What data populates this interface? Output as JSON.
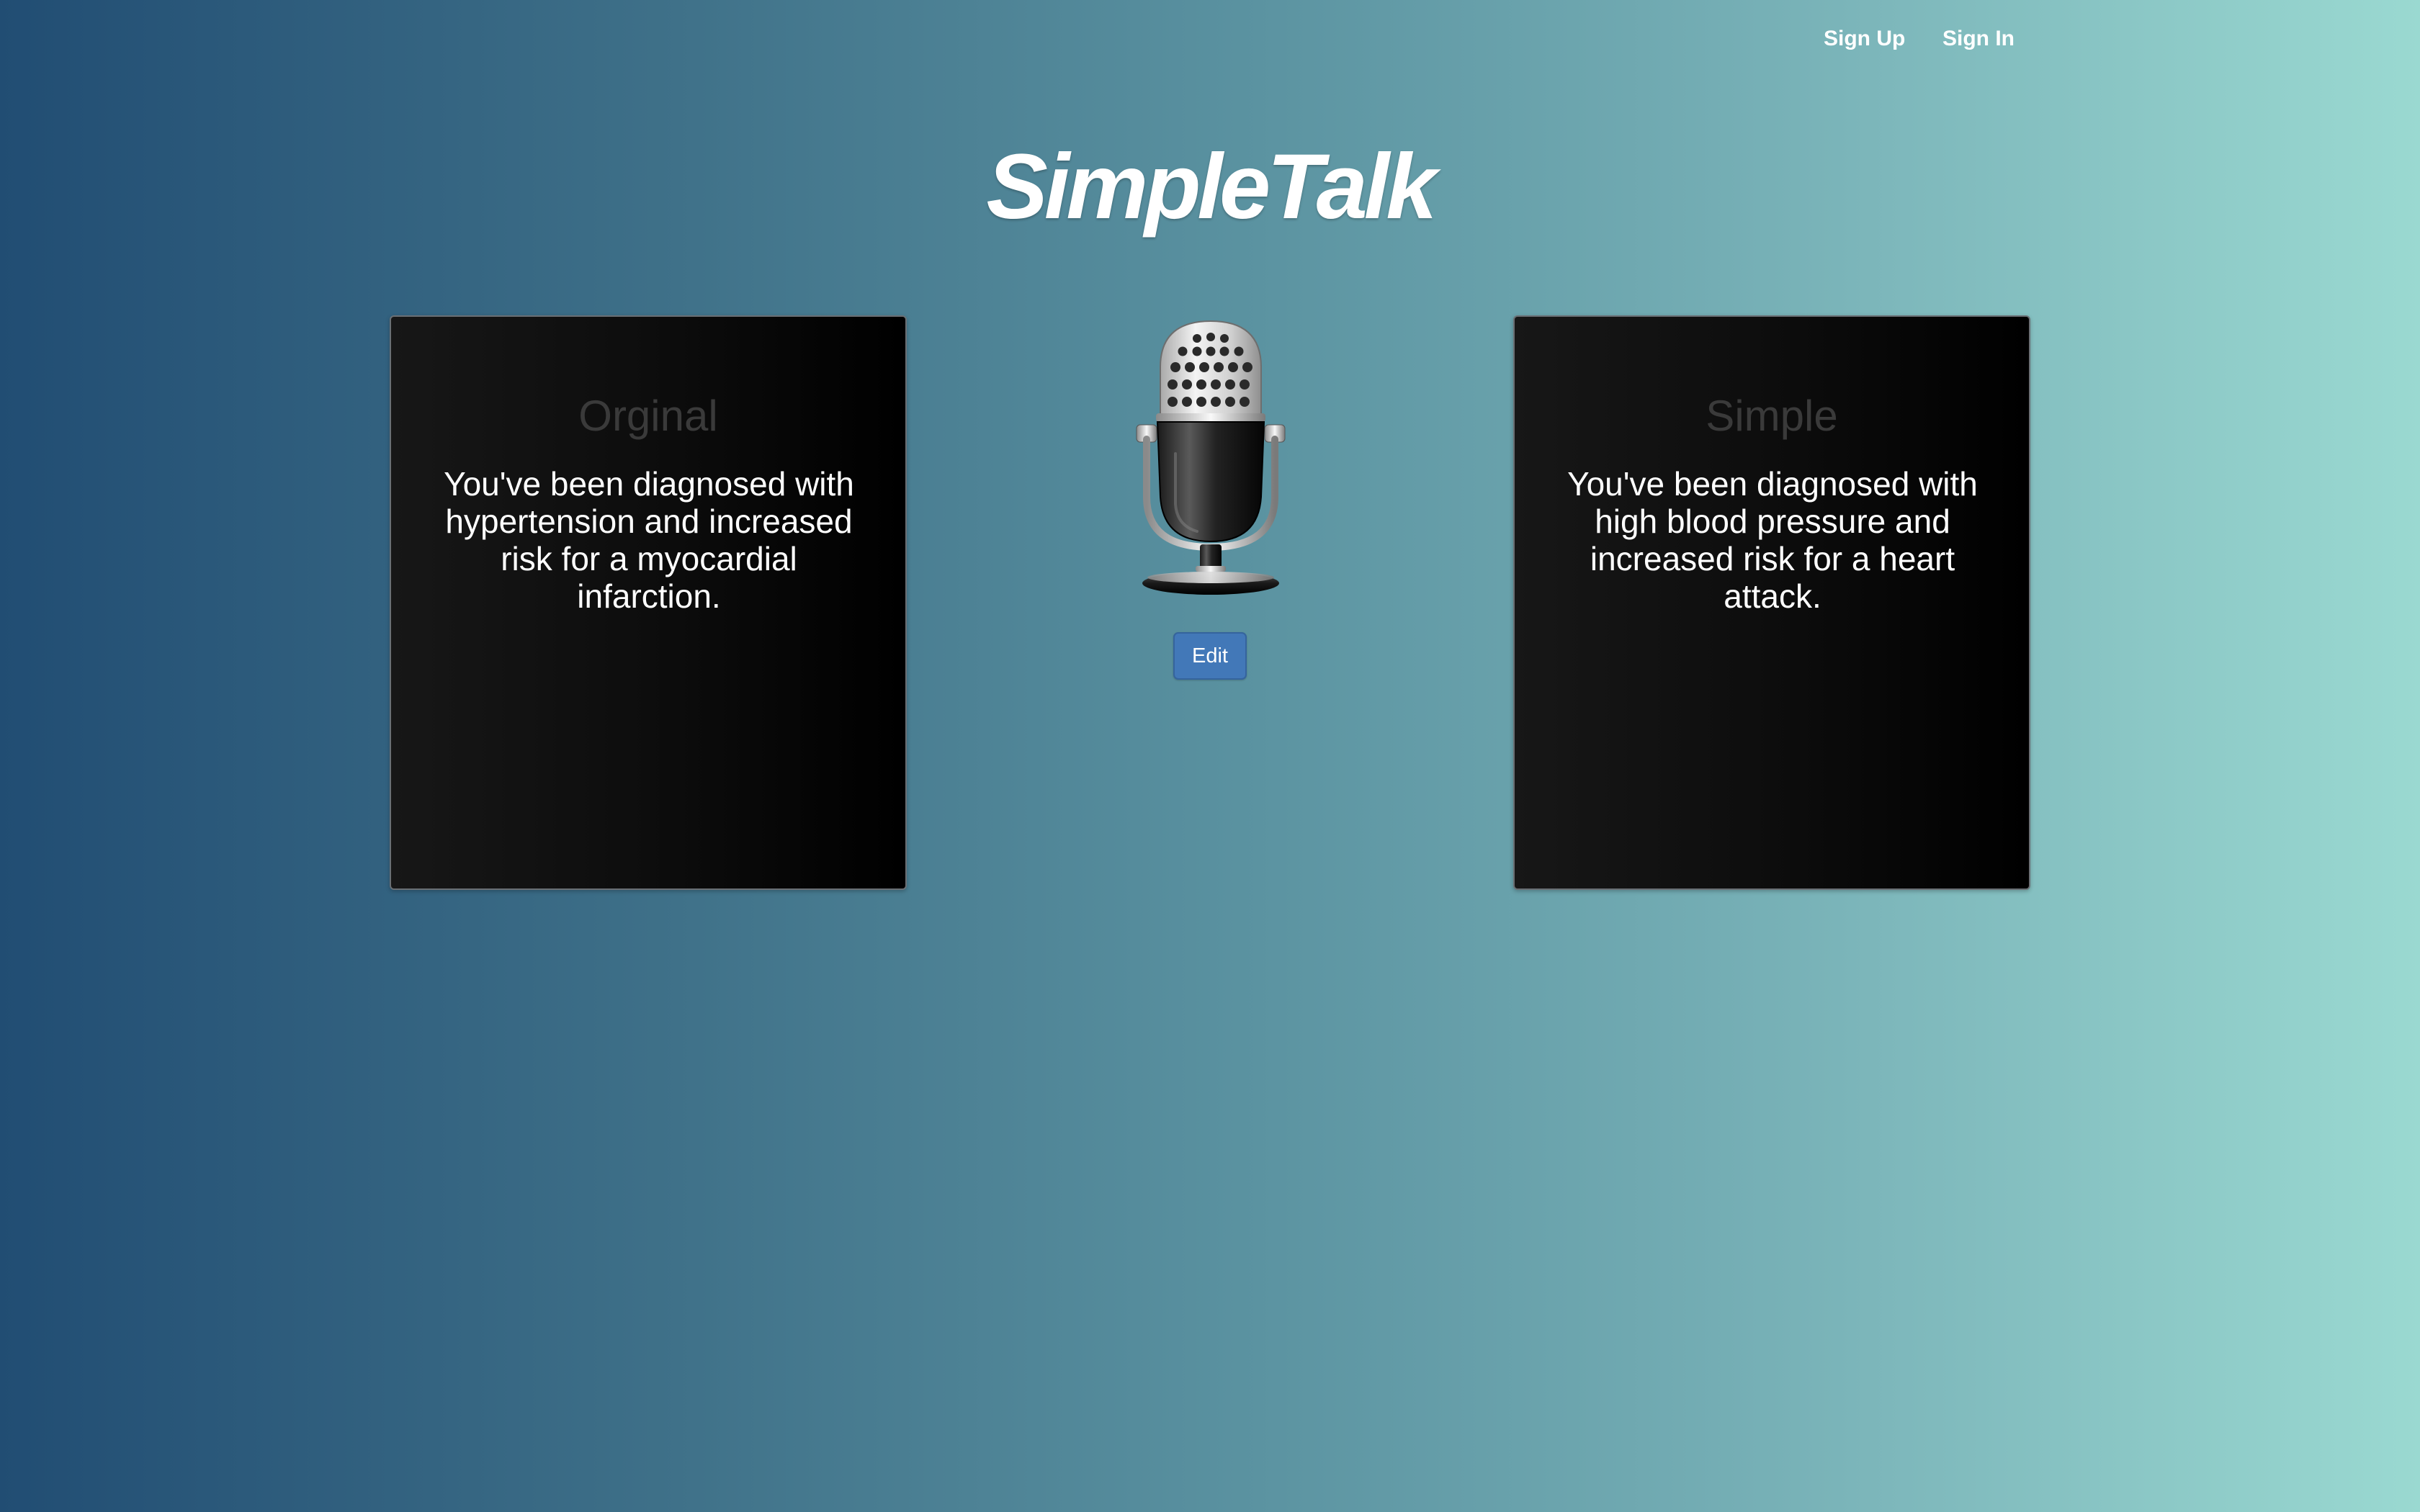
{
  "nav": {
    "links": [
      {
        "label": "Sign Up"
      },
      {
        "label": "Sign In"
      }
    ]
  },
  "brand": {
    "title": "SimpleTalk"
  },
  "panels": {
    "original": {
      "heading": "Orginal",
      "text": "You've been diagnosed with hypertension and increased risk for a myocardial infarction."
    },
    "simple": {
      "heading": "Simple",
      "text": "You've been diagnosed with high blood pressure and increased risk for a heart attack."
    }
  },
  "center": {
    "icon": "microphone-icon",
    "edit_label": "Edit"
  },
  "colors": {
    "background_start": "#214d73",
    "background_end": "#9ad9d1",
    "button": "#4278b8",
    "panel": "#0c0c0c"
  }
}
